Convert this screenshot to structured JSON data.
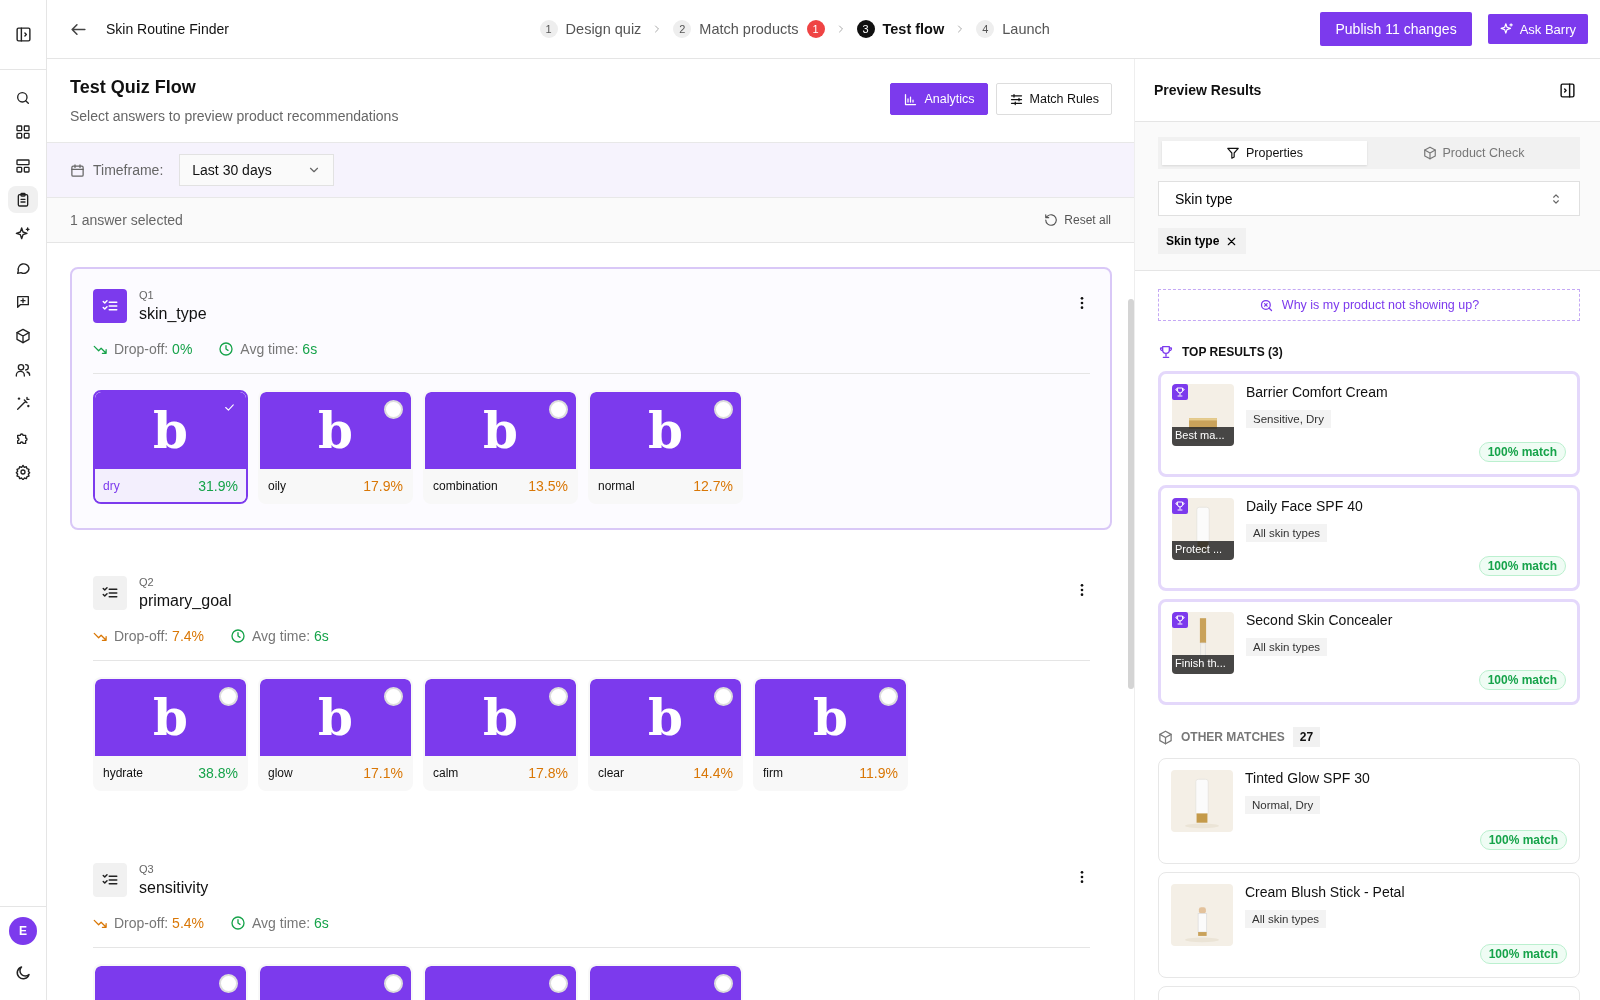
{
  "sidebar": {
    "items": [
      {
        "selected": false
      },
      {
        "selected": false
      },
      {
        "selected": false
      },
      {
        "selected": true
      },
      {
        "selected": false
      },
      {
        "selected": false
      },
      {
        "selected": false
      },
      {
        "selected": false
      },
      {
        "selected": false
      },
      {
        "selected": false
      },
      {
        "selected": false
      },
      {
        "selected": false
      }
    ],
    "avatar": "E"
  },
  "header": {
    "title": "Skin Routine Finder",
    "steps": [
      {
        "number": "1",
        "label": "Design quiz",
        "selected": false
      },
      {
        "number": "2",
        "label": "Match products",
        "selected": false,
        "badge": "1"
      },
      {
        "number": "3",
        "label": "Test flow",
        "selected": true
      },
      {
        "number": "4",
        "label": "Launch",
        "selected": false
      }
    ],
    "publish_button": "Publish 11 changes",
    "assistant_button": "Ask Barry"
  },
  "page": {
    "title": "Test Quiz Flow",
    "subtitle": "Select answers to preview product recommendations",
    "buttons": [
      {
        "label": "Analytics",
        "kind": "primary"
      },
      {
        "label": "Match Rules",
        "kind": "secondary"
      }
    ]
  },
  "filter": {
    "label": "Timeframe:",
    "value": "Last 30 days"
  },
  "selection": {
    "summary": "1 answer selected",
    "reset": "Reset all"
  },
  "questions": [
    {
      "number": "Q1",
      "name": "skin_type",
      "selected": true,
      "dropoff_label": "Drop-off:",
      "dropoff": "0%",
      "color": "#16a34a",
      "time_label": "Avg time:",
      "time": "6s",
      "options": [
        {
          "kind": "full",
          "logo": "b",
          "label": "dry",
          "share": "31.9%",
          "color": "#16a34a",
          "selected": true
        },
        {
          "kind": "full",
          "logo": "b",
          "label": "oily",
          "share": "17.9%",
          "color": "#d97706",
          "selected": false
        },
        {
          "kind": "full",
          "logo": "b",
          "label": "combination",
          "share": "13.5%",
          "color": "#d97706",
          "selected": false
        },
        {
          "kind": "full",
          "logo": "b",
          "label": "normal",
          "share": "12.7%",
          "color": "#d97706",
          "selected": false
        }
      ]
    },
    {
      "number": "Q2",
      "name": "primary_goal",
      "selected": false,
      "dropoff_label": "Drop-off:",
      "dropoff": "7.4%",
      "color": "#d97706",
      "time_label": "Avg time:",
      "time": "6s",
      "options": [
        {
          "kind": "full",
          "logo": "b",
          "label": "hydrate",
          "share": "38.8%",
          "color": "#16a34a",
          "selected": false
        },
        {
          "kind": "full",
          "logo": "b",
          "label": "glow",
          "share": "17.1%",
          "color": "#d97706",
          "selected": false
        },
        {
          "kind": "full",
          "logo": "b",
          "label": "calm",
          "share": "17.8%",
          "color": "#d97706",
          "selected": false
        },
        {
          "kind": "full",
          "logo": "b",
          "label": "clear",
          "share": "14.4%",
          "color": "#d97706",
          "selected": false
        },
        {
          "kind": "full",
          "logo": "b",
          "label": "firm",
          "share": "11.9%",
          "color": "#d97706",
          "selected": false
        }
      ]
    },
    {
      "number": "Q3",
      "name": "sensitivity",
      "selected": false,
      "dropoff_label": "Drop-off:",
      "dropoff": "5.4%",
      "color": "#d97706",
      "time_label": "Avg time:",
      "time": "6s",
      "options": [
        {
          "kind": "cut",
          "selected": false
        },
        {
          "kind": "cut",
          "selected": false
        },
        {
          "kind": "cut",
          "selected": false
        },
        {
          "kind": "cut",
          "selected": false
        }
      ]
    }
  ],
  "preview": {
    "title": "Preview Results",
    "tabs": [
      {
        "label": "Properties",
        "selected": true
      },
      {
        "label": "Product Check",
        "selected": false
      }
    ],
    "select": {
      "value": "Skin type"
    },
    "chips": [
      {
        "label": "Skin type"
      }
    ],
    "help_link": "Why is my product not showing up?",
    "top_heading": "TOP RESULTS (3)",
    "top_results": [
      {
        "name": "Barrier Comfort Cream",
        "caption": "Best ma...",
        "tag": "Sensitive, Dry",
        "match": "100% match",
        "top": true
      },
      {
        "name": "Daily Face SPF 40",
        "caption": "Protect ...",
        "tag": "All skin types",
        "match": "100% match",
        "top": true
      },
      {
        "name": "Second Skin Concealer",
        "caption": "Finish th...",
        "tag": "All skin types",
        "match": "100% match",
        "top": true
      }
    ],
    "other_heading": "OTHER MATCHES",
    "other_count": "27",
    "other_matches": [
      {
        "name": "Tinted Glow SPF 30",
        "tag": "Normal, Dry",
        "match": "100% match",
        "top": false
      },
      {
        "name": "Cream Blush Stick - Petal",
        "tag": "All skin types",
        "match": "100% match",
        "top": false
      }
    ]
  }
}
